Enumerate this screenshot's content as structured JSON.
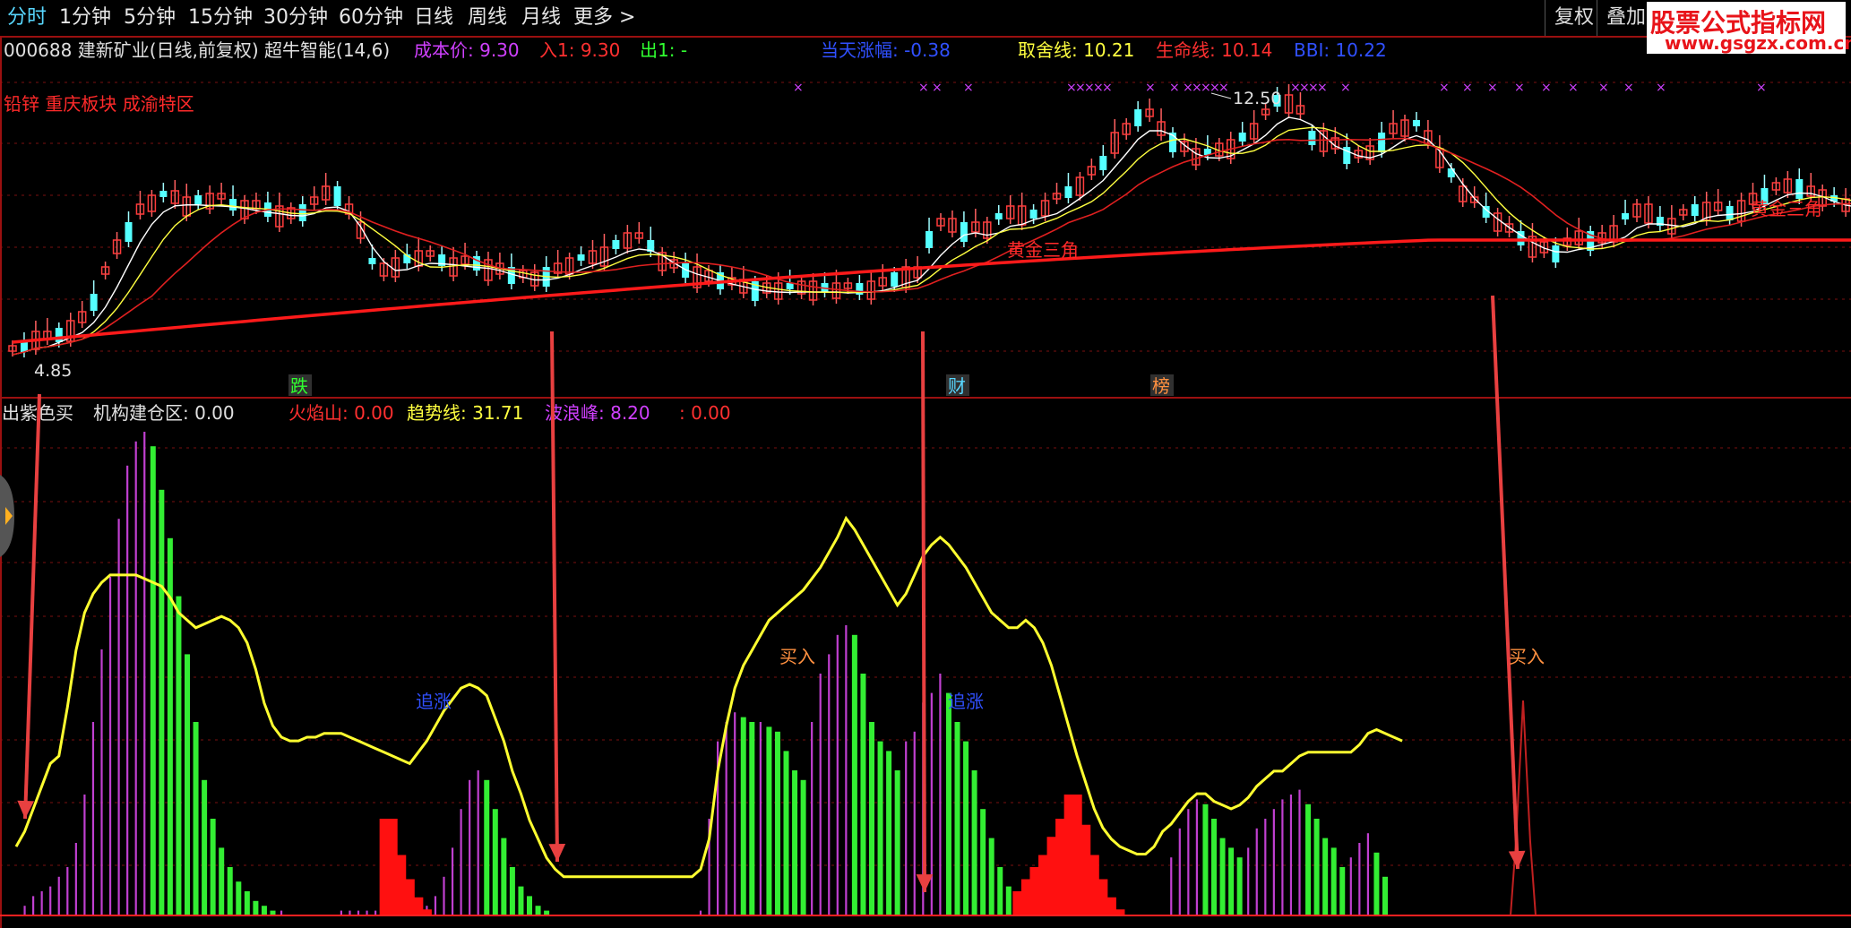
{
  "toolbar": {
    "periods": [
      "分时",
      "1分钟",
      "5分钟",
      "15分钟",
      "30分钟",
      "60分钟",
      "日线",
      "周线",
      "月线",
      "更多 >"
    ],
    "active_index": 0,
    "right_buttons": [
      "复权",
      "叠加"
    ]
  },
  "logo": {
    "line1": "股票公式指标网",
    "line2": "www.gsgzx.com.cn"
  },
  "price_panel": {
    "stock_info": "000688 建新矿业(日线,前复权) 超牛智能(14,6)",
    "cost_label": "成本价: 9.30",
    "in_label": "入1: 9.30",
    "out_label": "出1: -",
    "day_change": "当天涨幅: -0.38",
    "quit_line": "取舍线: 10.21",
    "life_line": "生命线: 10.14",
    "bbi": "BBI: 10.22",
    "concept": "铅锌 重庆板块 成渝特区",
    "high_price": "12.50",
    "low_price": "4.85",
    "triangle_label": "黄金三角",
    "markers": [
      "跌",
      "财",
      "榜"
    ]
  },
  "indicator_panel": {
    "title1": "出紫色买",
    "title2": "机构建仓区: 0.00",
    "huoyanshan": "火焰山: 0.00",
    "trend_line": "趋势线: 31.71",
    "wave_peak": "波浪峰: 8.20",
    "extra": ": 0.00",
    "buy_label": "买入",
    "chase_label": "追涨"
  },
  "colors": {
    "up": "#ff3b3b",
    "down": "#54ffff",
    "life_line": "#ff1a1a",
    "purple": "#c040d0",
    "green": "#33ee33",
    "yellow": "#ffff30",
    "arrow": "#e84040"
  },
  "chart_data": {
    "type": "bar",
    "title": "超牛智能",
    "series": [
      {
        "name": "趋势线",
        "values": [
          8,
          12,
          18,
          24,
          30,
          32,
          45,
          60,
          70,
          75,
          78,
          80,
          80,
          80,
          80,
          79,
          78,
          77,
          74,
          70,
          68,
          66,
          67,
          68,
          69,
          68,
          66,
          62,
          55,
          46,
          40,
          37,
          36,
          36,
          37,
          37,
          38,
          38,
          38,
          37,
          36,
          35,
          34,
          33,
          32,
          31,
          30,
          33,
          36,
          40,
          44,
          47,
          50,
          51,
          50,
          48,
          42,
          36,
          28,
          22,
          15,
          10,
          5,
          2,
          0,
          0,
          0,
          0,
          0,
          0,
          0,
          0,
          0,
          0,
          0,
          0,
          0,
          0,
          0,
          0,
          2,
          10,
          28,
          40,
          50,
          56,
          60,
          64,
          68,
          70,
          72,
          74,
          76,
          79,
          82,
          86,
          90,
          95,
          92,
          88,
          84,
          80,
          76,
          72,
          75,
          80,
          85,
          88,
          90,
          88,
          85,
          82,
          78,
          74,
          70,
          68,
          66,
          66,
          68,
          66,
          62,
          56,
          48,
          40,
          32,
          25,
          18,
          13,
          10,
          8,
          7,
          6,
          6,
          8,
          12,
          14,
          17,
          20,
          22,
          22,
          20,
          19,
          18,
          19,
          21,
          24,
          26,
          28,
          28,
          30,
          32,
          33,
          33,
          33,
          33,
          33,
          33,
          35,
          38,
          39,
          38,
          37,
          36
        ]
      },
      {
        "name": "波浪峰",
        "values": [
          0,
          2,
          4,
          5,
          6,
          8,
          10,
          15,
          25,
          40,
          55,
          70,
          82,
          93,
          98,
          100,
          97,
          88,
          78,
          66,
          54,
          40,
          28,
          20,
          14,
          10,
          7,
          5,
          3,
          2,
          1,
          1,
          0,
          0,
          0,
          0,
          0,
          0,
          1,
          1,
          1,
          1,
          1,
          0,
          0,
          0,
          0,
          1,
          2,
          4,
          8,
          14,
          22,
          28,
          30,
          28,
          22,
          16,
          10,
          6,
          4,
          2,
          1,
          0,
          0,
          0,
          0,
          0,
          0,
          0,
          0,
          0,
          0,
          0,
          0,
          0,
          0,
          0,
          0,
          0,
          1,
          20,
          36,
          40,
          42,
          41,
          40,
          40,
          39,
          38,
          34,
          30,
          28,
          40,
          50,
          54,
          58,
          60,
          58,
          50,
          40,
          36,
          34,
          30,
          36,
          38,
          44,
          46,
          50,
          46,
          40,
          36,
          30,
          22,
          16,
          10,
          6,
          4,
          3,
          2,
          1,
          1,
          0,
          0,
          0,
          0,
          0,
          0,
          0,
          0,
          0,
          0,
          0,
          0,
          0,
          12,
          18,
          22,
          24,
          23,
          20,
          16,
          14,
          12,
          14,
          18,
          20,
          22,
          24,
          25,
          26,
          23,
          20,
          16,
          14,
          10,
          12,
          15,
          17,
          13,
          8
        ]
      },
      {
        "name": "火焰山",
        "values": [
          0,
          0,
          0,
          0,
          0,
          0,
          0,
          0,
          0,
          0,
          0,
          0,
          0,
          0,
          0,
          0,
          0,
          0,
          0,
          0,
          0,
          0,
          0,
          0,
          0,
          0,
          0,
          0,
          0,
          0,
          0,
          0,
          0,
          0,
          0,
          0,
          0,
          0,
          0,
          0,
          0,
          0,
          0,
          16,
          16,
          10,
          6,
          3,
          1,
          0,
          0,
          0,
          0,
          0,
          0,
          0,
          0,
          0,
          0,
          0,
          0,
          0,
          0,
          0,
          0,
          0,
          0,
          0,
          0,
          0,
          0,
          0,
          0,
          0,
          0,
          0,
          0,
          0,
          0,
          0,
          0,
          0,
          0,
          0,
          0,
          0,
          0,
          0,
          0,
          0,
          0,
          0,
          0,
          0,
          0,
          0,
          0,
          0,
          0,
          0,
          0,
          0,
          0,
          0,
          0,
          0,
          0,
          0,
          0,
          0,
          0,
          0,
          0,
          0,
          0,
          0,
          0,
          4,
          6,
          8,
          10,
          13,
          16,
          20,
          20,
          15,
          10,
          6,
          3,
          1,
          0,
          0,
          0,
          0,
          0,
          0,
          0,
          0,
          0,
          0,
          0,
          0,
          0,
          0,
          0,
          0,
          0,
          0,
          0,
          0,
          0,
          0,
          0,
          0,
          0,
          0,
          0,
          0,
          0,
          0,
          0
        ]
      }
    ]
  }
}
